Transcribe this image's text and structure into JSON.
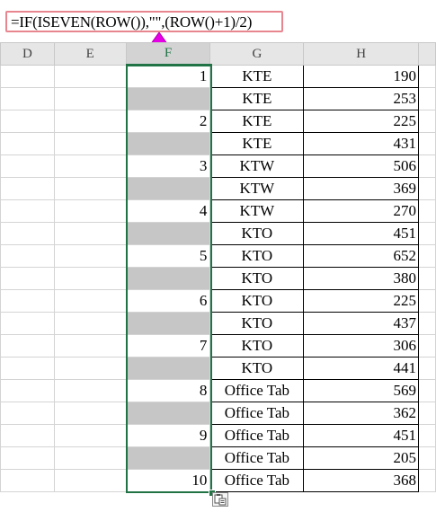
{
  "formula": "=IF(ISEVEN(ROW()),\"\",(ROW()+1)/2)",
  "columns": [
    "D",
    "E",
    "F",
    "G",
    "H"
  ],
  "rows": [
    {
      "f": "1",
      "g": "KTE",
      "h": "190"
    },
    {
      "f": "",
      "g": "KTE",
      "h": "253"
    },
    {
      "f": "2",
      "g": "KTE",
      "h": "225"
    },
    {
      "f": "",
      "g": "KTE",
      "h": "431"
    },
    {
      "f": "3",
      "g": "KTW",
      "h": "506"
    },
    {
      "f": "",
      "g": "KTW",
      "h": "369"
    },
    {
      "f": "4",
      "g": "KTW",
      "h": "270"
    },
    {
      "f": "",
      "g": "KTO",
      "h": "451"
    },
    {
      "f": "5",
      "g": "KTO",
      "h": "652"
    },
    {
      "f": "",
      "g": "KTO",
      "h": "380"
    },
    {
      "f": "6",
      "g": "KTO",
      "h": "225"
    },
    {
      "f": "",
      "g": "KTO",
      "h": "437"
    },
    {
      "f": "7",
      "g": "KTO",
      "h": "306"
    },
    {
      "f": "",
      "g": "KTO",
      "h": "441"
    },
    {
      "f": "8",
      "g": "Office Tab",
      "h": "569"
    },
    {
      "f": "",
      "g": "Office Tab",
      "h": "362"
    },
    {
      "f": "9",
      "g": "Office Tab",
      "h": "451"
    },
    {
      "f": "",
      "g": "Office Tab",
      "h": "205"
    },
    {
      "f": "10",
      "g": "Office Tab",
      "h": "368"
    }
  ],
  "colors": {
    "selection": "#217346",
    "blank_fill": "#c6c6c6",
    "highlight_border": "#e8868f",
    "arrow": "#e600e6"
  },
  "icons": {
    "paste_options": "paste-options-icon",
    "arrow": "arrow-up-icon"
  }
}
